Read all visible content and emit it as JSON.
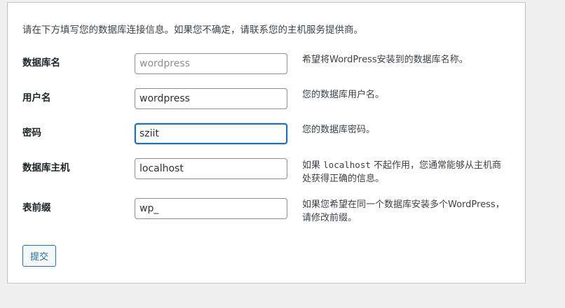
{
  "intro": "请在下方填写您的数据库连接信息。如果您不确定，请联系您的主机服务提供商。",
  "fields": [
    {
      "label": "数据库名",
      "value": "",
      "placeholder": "wordpress",
      "description": "希望将WordPress安装到的数据库名称。"
    },
    {
      "label": "用户名",
      "value": "wordpress",
      "placeholder": "",
      "description": "您的数据库用户名。"
    },
    {
      "label": "密码",
      "value": "sziit",
      "placeholder": "",
      "description": "您的数据库密码。"
    },
    {
      "label": "数据库主机",
      "value": "localhost",
      "placeholder": "",
      "description_before": "如果 ",
      "description_code": "localhost",
      "description_after": " 不起作用，您通常能够从主机商处获得正确的信息。"
    },
    {
      "label": "表前缀",
      "value": "wp_",
      "placeholder": "",
      "description": "如果您希望在同一个数据库安装多个WordPress，请修改前缀。"
    }
  ],
  "submit_label": "提交",
  "colors": {
    "accent": "#2271b1",
    "background": "#f0f0f1",
    "card": "#ffffff"
  }
}
